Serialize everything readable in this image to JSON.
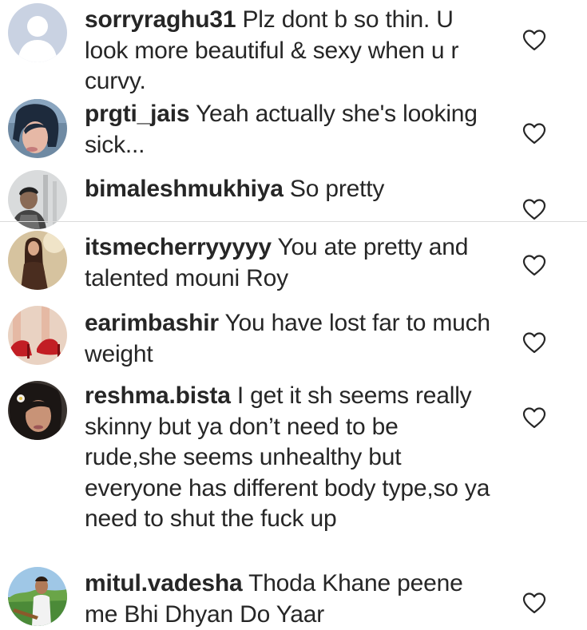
{
  "comments": [
    {
      "username": "sorryraghu31",
      "text": "Plz dont b so thin. U look more beautiful & sexy when u r curvy.",
      "avatar_icon": "default-profile-icon",
      "like_icon": "heart-outline-icon"
    },
    {
      "username": "prgti_jais",
      "text": "Yeah actually she's looking sick...",
      "avatar_icon": "profile-photo",
      "like_icon": "heart-outline-icon"
    },
    {
      "username": "bimaleshmukhiya",
      "text": "So pretty",
      "avatar_icon": "profile-photo",
      "like_icon": "heart-outline-icon"
    },
    {
      "username": "itsmecherryyyyy",
      "text": "You ate pretty and talented mouni Roy",
      "avatar_icon": "profile-photo",
      "like_icon": "heart-outline-icon"
    },
    {
      "username": "earimbashir",
      "text": "You have lost far to much weight",
      "avatar_icon": "profile-photo",
      "like_icon": "heart-outline-icon"
    },
    {
      "username": "reshma.bista",
      "text": "I get it sh seems really skinny but ya don’t need to be rude,she seems unhealthy but everyone has different body type,so ya need to shut the fuck up",
      "avatar_icon": "profile-photo",
      "like_icon": "heart-outline-icon"
    },
    {
      "username": "mitul.vadesha",
      "text": "Thoda Khane peene me Bhi Dhyan Do Yaar",
      "avatar_icon": "profile-photo",
      "like_icon": "heart-outline-icon"
    }
  ],
  "colors": {
    "text": "#262626",
    "divider": "#dbdbdb",
    "heart_outline": "#262626",
    "default_avatar_bg": "#c7d0e0"
  }
}
